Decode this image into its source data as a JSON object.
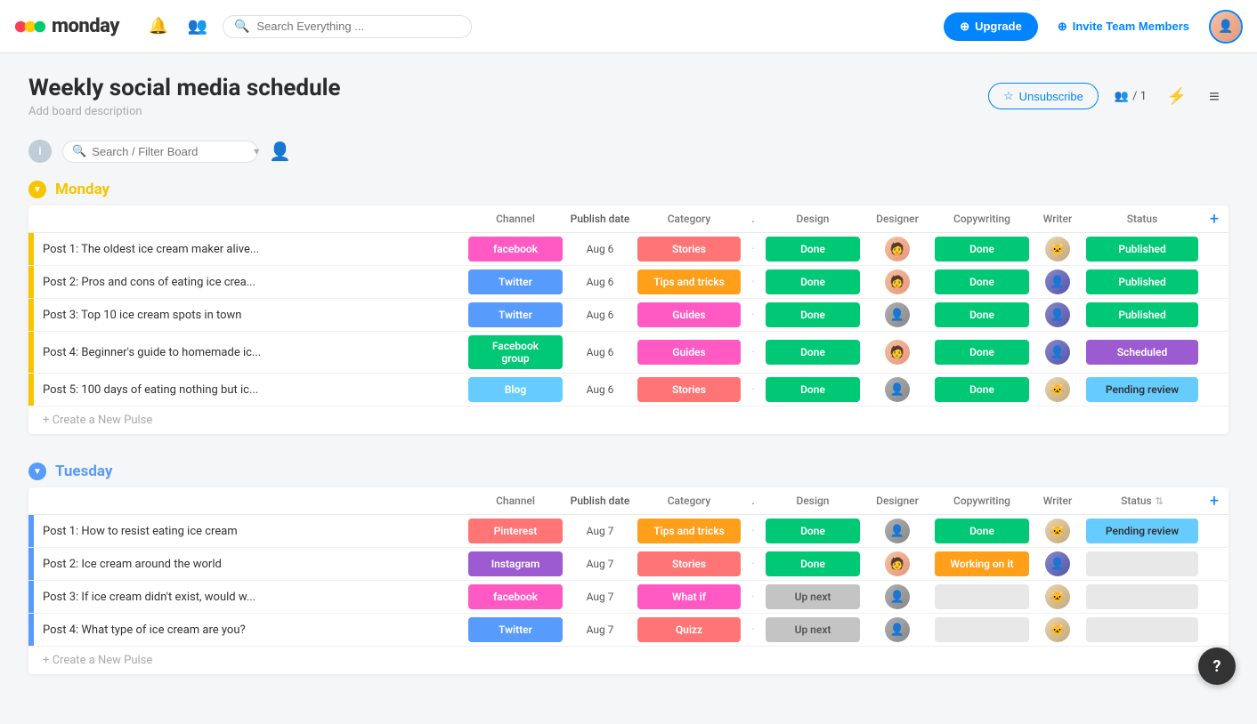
{
  "header": {
    "logo_text": "monday",
    "search_placeholder": "Search Everything ...",
    "upgrade_label": "Upgrade",
    "invite_label": "Invite Team Members"
  },
  "board": {
    "title": "Weekly social media schedule",
    "description": "Add board description",
    "search_filter_placeholder": "Search / Filter Board",
    "unsubscribe_label": "Unsubscribe",
    "members_count": "/ 1"
  },
  "groups": [
    {
      "id": "monday",
      "title": "Monday",
      "color": "#f7c400",
      "columns": [
        "Channel",
        "Publish date",
        "Category",
        ".",
        "Design",
        "Designer",
        "Copywriting",
        "Writer",
        "Status"
      ],
      "rows": [
        {
          "name": "Post 1: The oldest ice cream maker alive...",
          "channel": "facebook",
          "channel_class": "ch-facebook",
          "date": "Aug 6",
          "category": "Stories",
          "cat_class": "cat-stories",
          "design": "Done",
          "design_class": "ds-done",
          "designer": "woman",
          "copywriting": "Done",
          "copy_class": "cw-done",
          "writer": "cat",
          "status": "Published",
          "status_class": "st-published"
        },
        {
          "name": "Post 2: Pros and cons of eating ice crea...",
          "channel": "Twitter",
          "channel_class": "ch-twitter",
          "date": "Aug 6",
          "category": "Tips and tricks",
          "cat_class": "cat-tips",
          "design": "Done",
          "design_class": "ds-done",
          "designer": "woman",
          "copywriting": "Done",
          "copy_class": "cw-done",
          "writer": "man",
          "status": "Published",
          "status_class": "st-published"
        },
        {
          "name": "Post 3: Top 10 ice cream spots in town",
          "channel": "Twitter",
          "channel_class": "ch-twitter",
          "date": "Aug 6",
          "category": "Guides",
          "cat_class": "cat-guides",
          "design": "Done",
          "design_class": "ds-done",
          "designer": "man",
          "copywriting": "Done",
          "copy_class": "cw-done",
          "writer": "man",
          "status": "Published",
          "status_class": "st-published"
        },
        {
          "name": "Post 4: Beginner's guide to homemade ic...",
          "channel": "Facebook group",
          "channel_class": "ch-facebook-group",
          "date": "Aug 6",
          "category": "Guides",
          "cat_class": "cat-guides",
          "design": "Done",
          "design_class": "ds-done",
          "designer": "woman",
          "copywriting": "Done",
          "copy_class": "cw-done",
          "writer": "man",
          "status": "Scheduled",
          "status_class": "st-scheduled"
        },
        {
          "name": "Post 5: 100 days of eating nothing but ic...",
          "channel": "Blog",
          "channel_class": "ch-blog",
          "date": "Aug 6",
          "category": "Stories",
          "cat_class": "cat-stories",
          "design": "Done",
          "design_class": "ds-done",
          "designer": "man",
          "copywriting": "Done",
          "copy_class": "cw-done",
          "writer": "cat",
          "status": "Pending review",
          "status_class": "st-pending"
        }
      ],
      "create_label": "+ Create a New Pulse"
    },
    {
      "id": "tuesday",
      "title": "Tuesday",
      "color": "#579bfc",
      "columns": [
        "Channel",
        "Publish date",
        "Category",
        ".",
        "Design",
        "Designer",
        "Copywriting",
        "Writer",
        "Status"
      ],
      "rows": [
        {
          "name": "Post 1: How to resist eating ice cream",
          "channel": "Pinterest",
          "channel_class": "ch-pinterest",
          "date": "Aug 7",
          "category": "Tips and tricks",
          "cat_class": "cat-tips",
          "design": "Done",
          "design_class": "ds-done",
          "designer": "man",
          "copywriting": "Done",
          "copy_class": "cw-done",
          "writer": "cat",
          "status": "Pending review",
          "status_class": "st-pending"
        },
        {
          "name": "Post 2: Ice cream around the world",
          "channel": "Instagram",
          "channel_class": "ch-instagram",
          "date": "Aug 7",
          "category": "Stories",
          "cat_class": "cat-stories",
          "design": "Done",
          "design_class": "ds-done",
          "designer": "woman",
          "copywriting": "Working on it",
          "copy_class": "cw-working",
          "writer": "man",
          "status": "",
          "status_class": "st-blank"
        },
        {
          "name": "Post 3: If ice cream didn't exist, would w...",
          "channel": "facebook",
          "channel_class": "ch-facebook",
          "date": "Aug 7",
          "category": "What if",
          "cat_class": "cat-whatif",
          "design": "Up next",
          "design_class": "ds-upnext",
          "designer": "man",
          "copywriting": "",
          "copy_class": "cw-blank",
          "writer": "cat",
          "status": "",
          "status_class": "st-blank"
        },
        {
          "name": "Post 4: What type of ice cream are you?",
          "channel": "Twitter",
          "channel_class": "ch-twitter",
          "date": "Aug 7",
          "category": "Quizz",
          "cat_class": "cat-quizz",
          "design": "Up next",
          "design_class": "ds-upnext",
          "designer": "man",
          "copywriting": "",
          "copy_class": "cw-blank",
          "writer": "cat",
          "status": "",
          "status_class": "st-blank"
        }
      ],
      "create_label": "+ Create a New Pulse"
    }
  ],
  "help": "?"
}
